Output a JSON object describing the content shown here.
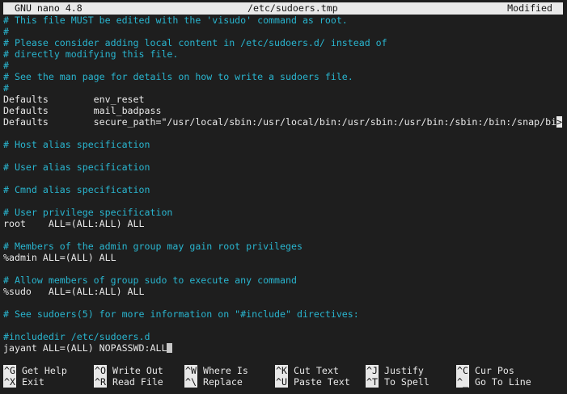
{
  "titlebar": {
    "app": "GNU nano 4.8",
    "file": "/etc/sudoers.tmp",
    "status": "Modified"
  },
  "buffer": {
    "lines": [
      {
        "text": "# This file MUST be edited with the 'visudo' command as root.",
        "kind": "comment"
      },
      {
        "text": "#",
        "kind": "comment"
      },
      {
        "text": "# Please consider adding local content in /etc/sudoers.d/ instead of",
        "kind": "comment"
      },
      {
        "text": "# directly modifying this file.",
        "kind": "comment"
      },
      {
        "text": "#",
        "kind": "comment"
      },
      {
        "text": "# See the man page for details on how to write a sudoers file.",
        "kind": "comment"
      },
      {
        "text": "#",
        "kind": "comment"
      },
      {
        "text": "Defaults        env_reset",
        "kind": "code"
      },
      {
        "text": "Defaults        mail_badpass",
        "kind": "code"
      },
      {
        "text": "Defaults        secure_path=\"/usr/local/sbin:/usr/local/bin:/usr/sbin:/usr/bin:/sbin:/bin:/snap/bi",
        "kind": "code",
        "overflow": ">"
      },
      {
        "text": "",
        "kind": "code"
      },
      {
        "text": "# Host alias specification",
        "kind": "comment"
      },
      {
        "text": "",
        "kind": "code"
      },
      {
        "text": "# User alias specification",
        "kind": "comment"
      },
      {
        "text": "",
        "kind": "code"
      },
      {
        "text": "# Cmnd alias specification",
        "kind": "comment"
      },
      {
        "text": "",
        "kind": "code"
      },
      {
        "text": "# User privilege specification",
        "kind": "comment"
      },
      {
        "text": "root    ALL=(ALL:ALL) ALL",
        "kind": "code"
      },
      {
        "text": "",
        "kind": "code"
      },
      {
        "text": "# Members of the admin group may gain root privileges",
        "kind": "comment"
      },
      {
        "text": "%admin ALL=(ALL) ALL",
        "kind": "code"
      },
      {
        "text": "",
        "kind": "code"
      },
      {
        "text": "# Allow members of group sudo to execute any command",
        "kind": "comment"
      },
      {
        "text": "%sudo   ALL=(ALL:ALL) ALL",
        "kind": "code"
      },
      {
        "text": "",
        "kind": "code"
      },
      {
        "text": "# See sudoers(5) for more information on \"#include\" directives:",
        "kind": "comment"
      },
      {
        "text": "",
        "kind": "code"
      },
      {
        "text": "#includedir /etc/sudoers.d",
        "kind": "comment"
      },
      {
        "text": "jayant ALL=(ALL) NOPASSWD:ALL",
        "kind": "code",
        "cursor": true
      }
    ]
  },
  "shortcuts": [
    {
      "key": "^G",
      "label": "Get Help"
    },
    {
      "key": "^O",
      "label": "Write Out"
    },
    {
      "key": "^W",
      "label": "Where Is"
    },
    {
      "key": "^K",
      "label": "Cut Text"
    },
    {
      "key": "^J",
      "label": "Justify"
    },
    {
      "key": "^C",
      "label": "Cur Pos"
    },
    {
      "key": "^X",
      "label": "Exit"
    },
    {
      "key": "^R",
      "label": "Read File"
    },
    {
      "key": "^\\",
      "label": "Replace"
    },
    {
      "key": "^U",
      "label": "Paste Text"
    },
    {
      "key": "^T",
      "label": "To Spell"
    },
    {
      "key": "^_",
      "label": "Go To Line"
    }
  ],
  "colors": {
    "background": "#1e1e1e",
    "comment": "#29b5cf",
    "text": "#e8e8e8",
    "titlebar_bg": "#e9e9e9"
  }
}
